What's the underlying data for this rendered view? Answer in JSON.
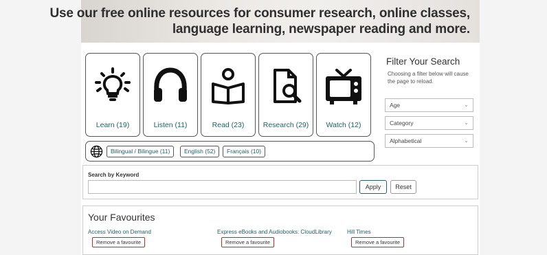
{
  "banner": {
    "line1": "Use our free online resources for consumer research, online classes,",
    "line2": "language learning, newspaper reading and more."
  },
  "categories": [
    {
      "label": "Learn (19)",
      "icon": "lightbulb-icon"
    },
    {
      "label": "Listen (11)",
      "icon": "headphones-icon"
    },
    {
      "label": "Read (23)",
      "icon": "book-reader-icon"
    },
    {
      "label": "Research (29)",
      "icon": "document-search-icon"
    },
    {
      "label": "Watch (12)",
      "icon": "tv-icon"
    }
  ],
  "languages": {
    "icon": "globe-icon",
    "options": [
      "Bilingual / Bilingue (11)",
      "English (52)",
      "Français (10)"
    ]
  },
  "filter": {
    "title": "Filter Your Search",
    "description": "Choosing a filter below will cause the page to reload.",
    "selects": [
      "Age",
      "Category",
      "Alphabetical"
    ]
  },
  "search": {
    "label": "Search by Keyword",
    "value": "",
    "apply_label": "Apply",
    "reset_label": "Reset"
  },
  "favourites": {
    "title": "Your Favourites",
    "items": [
      {
        "name": "Access Video on Demand",
        "button": "Remove a favourite"
      },
      {
        "name": "Express eBooks and Audiobooks: CloudLibrary",
        "button": "Remove a favourite"
      },
      {
        "name": "Hill Times",
        "button": "Remove a favourite"
      }
    ]
  },
  "colors": {
    "accent": "#1f5f63",
    "remove_border": "#b23030"
  }
}
